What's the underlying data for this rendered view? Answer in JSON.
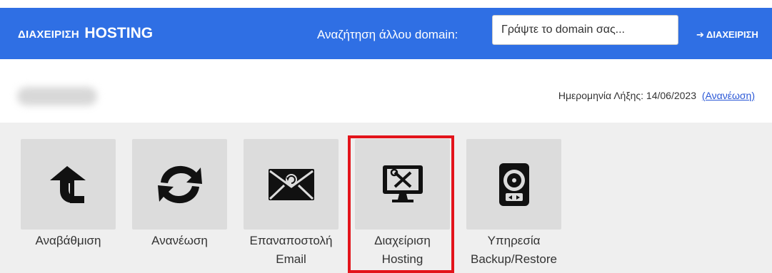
{
  "header": {
    "brand_prefix": "ΔΙΑΧΕΙΡΙΣΗ",
    "brand_main": "HOSTING",
    "search_label": "Αναζήτηση άλλου domain:",
    "search_placeholder": "Γράψτε το domain σας...",
    "manage_link": "➔ ΔΙΑΧΕΙΡΙΣΗ"
  },
  "info": {
    "expiry_label": "Ημερομηνία Λήξης: 14/06/2023",
    "renew_link": "(Ανανέωση)"
  },
  "actions": [
    {
      "label": "Αναβάθμιση",
      "icon": "upgrade-arrow-icon"
    },
    {
      "label": "Ανανέωση",
      "icon": "renew-arrows-icon"
    },
    {
      "label": "Επαναποστολή Email",
      "icon": "resend-email-icon"
    },
    {
      "label": "Διαχείριση Hosting",
      "icon": "monitor-tools-icon"
    },
    {
      "label": "Υπηρεσία Backup/Restore",
      "icon": "hard-drive-icon"
    }
  ],
  "colors": {
    "header_bg": "#2f6fe4",
    "tile_bg": "#dcdcdc",
    "panel_bg": "#efefef",
    "highlight_border": "#e3141b",
    "link": "#2a57d6"
  }
}
